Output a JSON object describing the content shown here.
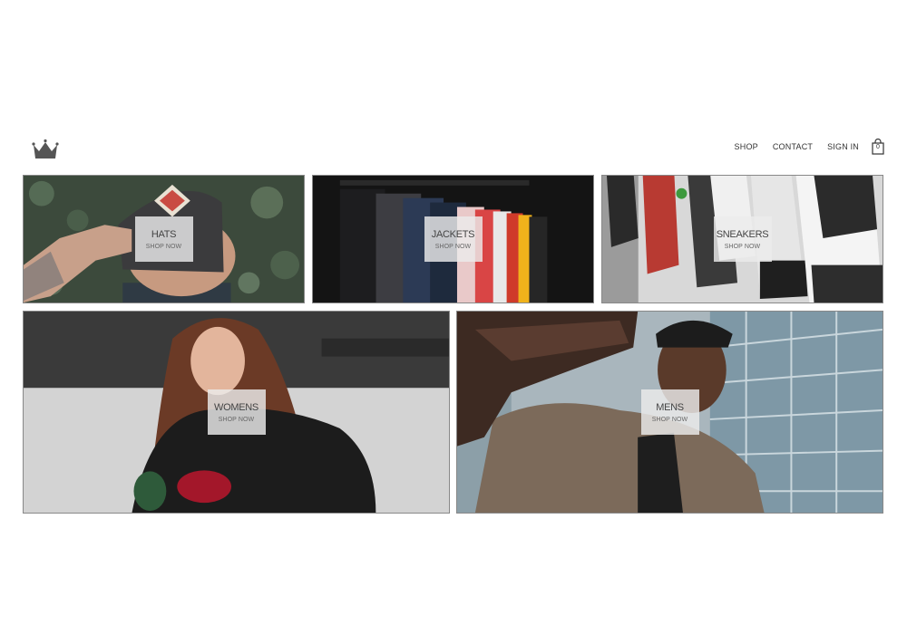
{
  "nav": {
    "logo_icon": "crown-icon",
    "links": [
      "SHOP",
      "CONTACT",
      "SIGN IN"
    ],
    "cart": {
      "icon": "shopping-bag-icon",
      "count": "0"
    }
  },
  "categories": [
    {
      "title": "HATS",
      "cta": "SHOP NOW"
    },
    {
      "title": "JACKETS",
      "cta": "SHOP NOW"
    },
    {
      "title": "SNEAKERS",
      "cta": "SHOP NOW"
    },
    {
      "title": "WOMENS",
      "cta": "SHOP NOW"
    },
    {
      "title": "MENS",
      "cta": "SHOP NOW"
    }
  ],
  "colors": {
    "text": "#333333",
    "overlay": "#ebebeb",
    "border": "#888888"
  }
}
